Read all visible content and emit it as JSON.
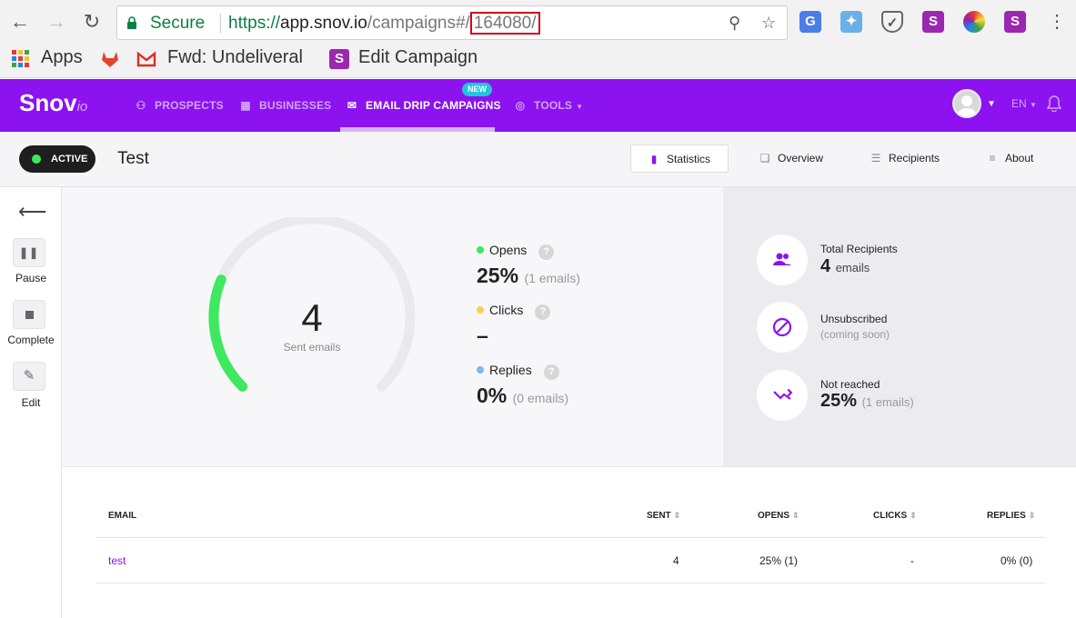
{
  "browser": {
    "secure_label": "Secure",
    "url_scheme": "https://",
    "url_host": "app.snov.io",
    "url_path": "/campaigns#/",
    "url_highlight": "164080/",
    "bookmarks": [
      {
        "label": "Apps"
      },
      {
        "label": "Fwd: Undeliveral"
      },
      {
        "label": "Edit Campaign"
      }
    ]
  },
  "app": {
    "logo_main": "Snov",
    "logo_suffix": "io",
    "menu": [
      {
        "label": "PROSPECTS",
        "icon": "people-icon"
      },
      {
        "label": "BUSINESSES",
        "icon": "building-icon"
      },
      {
        "label": "EMAIL DRIP CAMPAIGNS",
        "icon": "mail-icon",
        "badge": "NEW"
      },
      {
        "label": "TOOLS",
        "icon": "target-icon"
      }
    ],
    "language": "EN"
  },
  "campaign": {
    "status": "ACTIVE",
    "title": "Test",
    "tabs": [
      {
        "label": "Statistics",
        "icon": "bar-chart-icon"
      },
      {
        "label": "Overview",
        "icon": "overview-icon"
      },
      {
        "label": "Recipients",
        "icon": "recipients-icon"
      },
      {
        "label": "About",
        "icon": "list-icon"
      }
    ]
  },
  "rail": {
    "pause_label": "Pause",
    "complete_label": "Complete",
    "edit_label": "Edit"
  },
  "stats": {
    "sent_count": "4",
    "sent_label": "Sent emails",
    "gauge_fraction": 0.25,
    "metrics": [
      {
        "name": "Opens",
        "value": "25%",
        "sub": "(1 emails)",
        "color": "#3ee85f"
      },
      {
        "name": "Clicks",
        "value": "–",
        "sub": "",
        "color": "#f5d24a"
      },
      {
        "name": "Replies",
        "value": "0%",
        "sub": "(0 emails)",
        "color": "#7ab8f0"
      }
    ],
    "help": "?"
  },
  "summary": {
    "total_title": "Total Recipients",
    "total_value": "4",
    "total_unit": "emails",
    "unsub_title": "Unsubscribed",
    "unsub_note": "(coming soon)",
    "notreached_title": "Not reached",
    "notreached_value": "25%",
    "notreached_sub": "(1 emails)"
  },
  "table": {
    "headers": [
      "EMAIL",
      "SENT",
      "OPENS",
      "CLICKS",
      "REPLIES"
    ],
    "rows": [
      {
        "email": "test",
        "sent": "4",
        "opens": "25% (1)",
        "clicks": "-",
        "replies": "0% (0)"
      }
    ]
  },
  "colors": {
    "brand": "#8c12f0",
    "gauge_active": "#3ee85f",
    "gauge_track": "#eaeaee"
  }
}
